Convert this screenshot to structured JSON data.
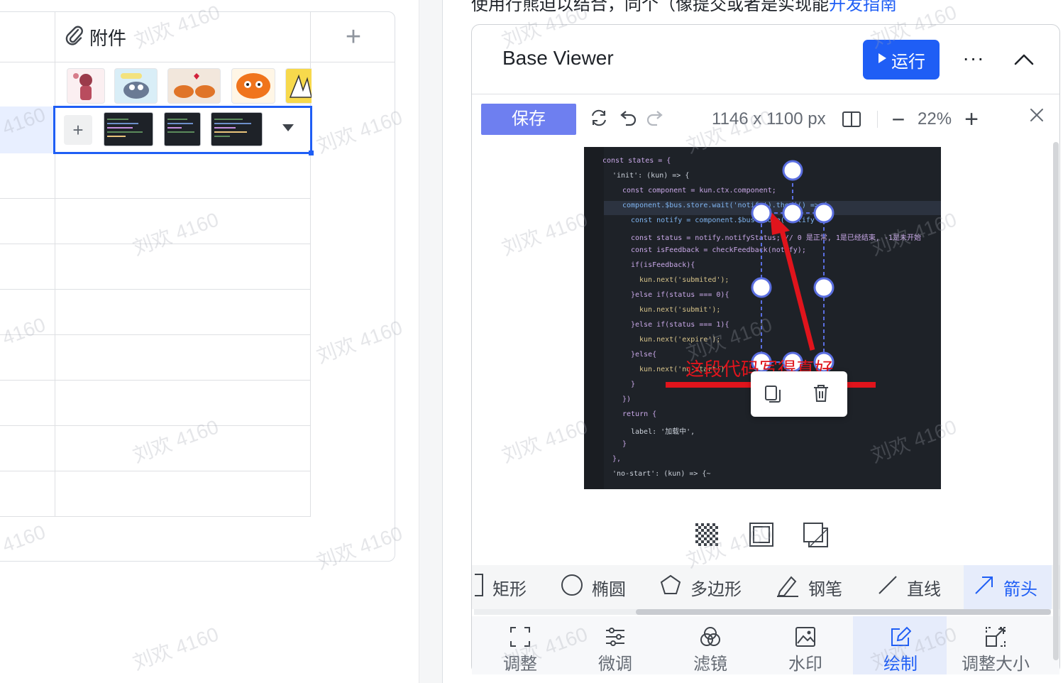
{
  "table": {
    "column_header": "附件",
    "add_column_symbol": "+",
    "add_attachment_symbol": "+"
  },
  "top_text": {
    "prefix": "使用行熊迫以结合，同个（像提交或者是实现能",
    "link": "开发指南"
  },
  "viewer": {
    "title": "Base Viewer",
    "run_label": "运行",
    "more": "···"
  },
  "editor": {
    "save_label": "保存",
    "dimensions": "1146 x 1100 px",
    "zoom": "22%",
    "annotation_text": "这段代码写得真好"
  },
  "code_lines": [
    "const states = {",
    "  'init': (kun) => {",
    "    const component = kun.ctx.component;",
    "    component.$bus.store.wait('notify').then(() => {",
    "      const notify = component.$bus.store('notify');",
    "      const status = notify.notifyStatus; // 0 是正常, 1是已经结束, -1是未开始",
    "      const isFeedback = checkFeedback(notify);",
    "      if(isFeedback){",
    "        kun.next('submited');",
    "      }else if(status === 0){",
    "        kun.next('submit');",
    "      }else if(status === 1){",
    "        kun.next('expire');",
    "      }else{",
    "        kun.next('no-start');",
    "      }",
    "    })",
    "    return {",
    "      label: '加载中',",
    "    }",
    "  },",
    "  'no-start': (kun) => {~"
  ],
  "shapes": [
    "矩形",
    "椭圆",
    "多边形",
    "钢笔",
    "直线",
    "箭头"
  ],
  "tabs": [
    "调整",
    "微调",
    "滤镜",
    "水印",
    "绘制",
    "调整大小"
  ],
  "watermark": "刘欢 4160",
  "colors": {
    "accent": "#1f5ef5",
    "save_button": "#6e7ff0",
    "annotation": "#e0141c",
    "selected_tab_bg": "#e6ecfb"
  }
}
